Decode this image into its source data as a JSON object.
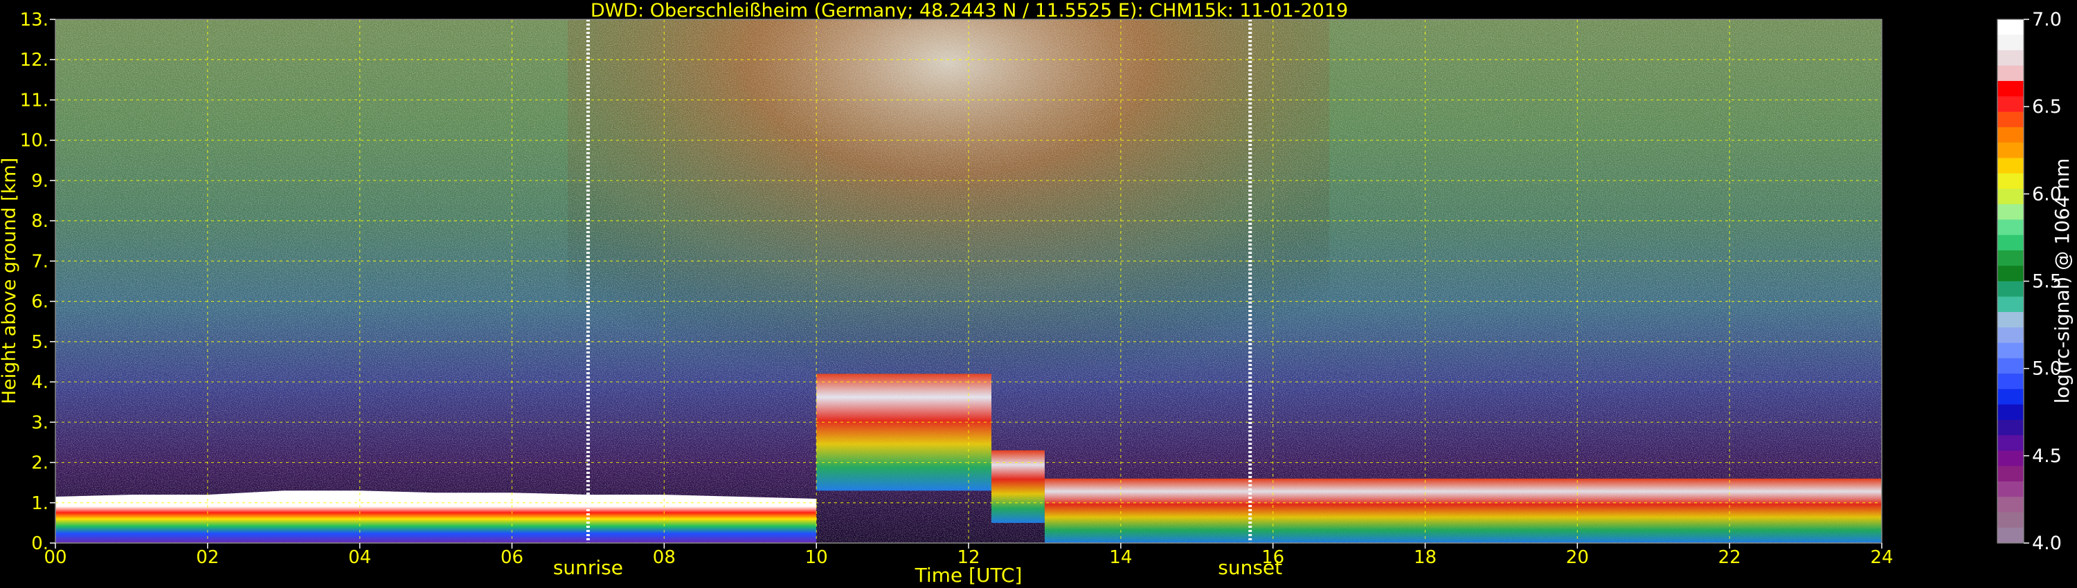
{
  "chart_data": {
    "type": "heatmap",
    "title": "DWD: Oberschleißheim (Germany; 48.2443 N / 11.5525 E):    CHM15k: 11-01-2019",
    "xlabel": "Time [UTC]",
    "ylabel": "Height above ground [km]",
    "colorbar_label": "log(rc-signal) @ 1064 nm",
    "xlim": [
      0,
      24
    ],
    "ylim": [
      0,
      13
    ],
    "clim": [
      4.0,
      7.0
    ],
    "x_ticks": [
      "00",
      "02",
      "04",
      "06",
      "08",
      "10",
      "12",
      "14",
      "16",
      "18",
      "20",
      "22",
      "24"
    ],
    "y_ticks": [
      "0.",
      "1.",
      "2.",
      "3.",
      "4.",
      "5.",
      "6.",
      "7.",
      "8.",
      "9.",
      "10.",
      "11.",
      "12.",
      "13."
    ],
    "colorbar_ticks": [
      "4.0",
      "4.5",
      "5.0",
      "5.5",
      "6.0",
      "6.5",
      "7.0"
    ],
    "grid": true,
    "annotations": [
      {
        "label": "sunrise",
        "x": 7.0
      },
      {
        "label": "sunset",
        "x": 15.7
      }
    ],
    "boundary_layer_top_km": [
      [
        0.0,
        1.15
      ],
      [
        1.0,
        1.2
      ],
      [
        2.0,
        1.2
      ],
      [
        3.0,
        1.3
      ],
      [
        4.0,
        1.3
      ],
      [
        5.0,
        1.25
      ],
      [
        6.0,
        1.25
      ],
      [
        7.0,
        1.2
      ],
      [
        8.0,
        1.2
      ],
      [
        9.0,
        1.15
      ],
      [
        10.0,
        1.1
      ]
    ],
    "cloud_layers_km": [
      {
        "x_start": 10.0,
        "x_end": 12.3,
        "base": 1.3,
        "top": 4.2
      },
      {
        "x_start": 12.3,
        "x_end": 13.0,
        "base": 0.5,
        "top": 2.3
      },
      {
        "x_start": 13.0,
        "x_end": 24.0,
        "base": 0.0,
        "top": 1.6
      }
    ]
  }
}
